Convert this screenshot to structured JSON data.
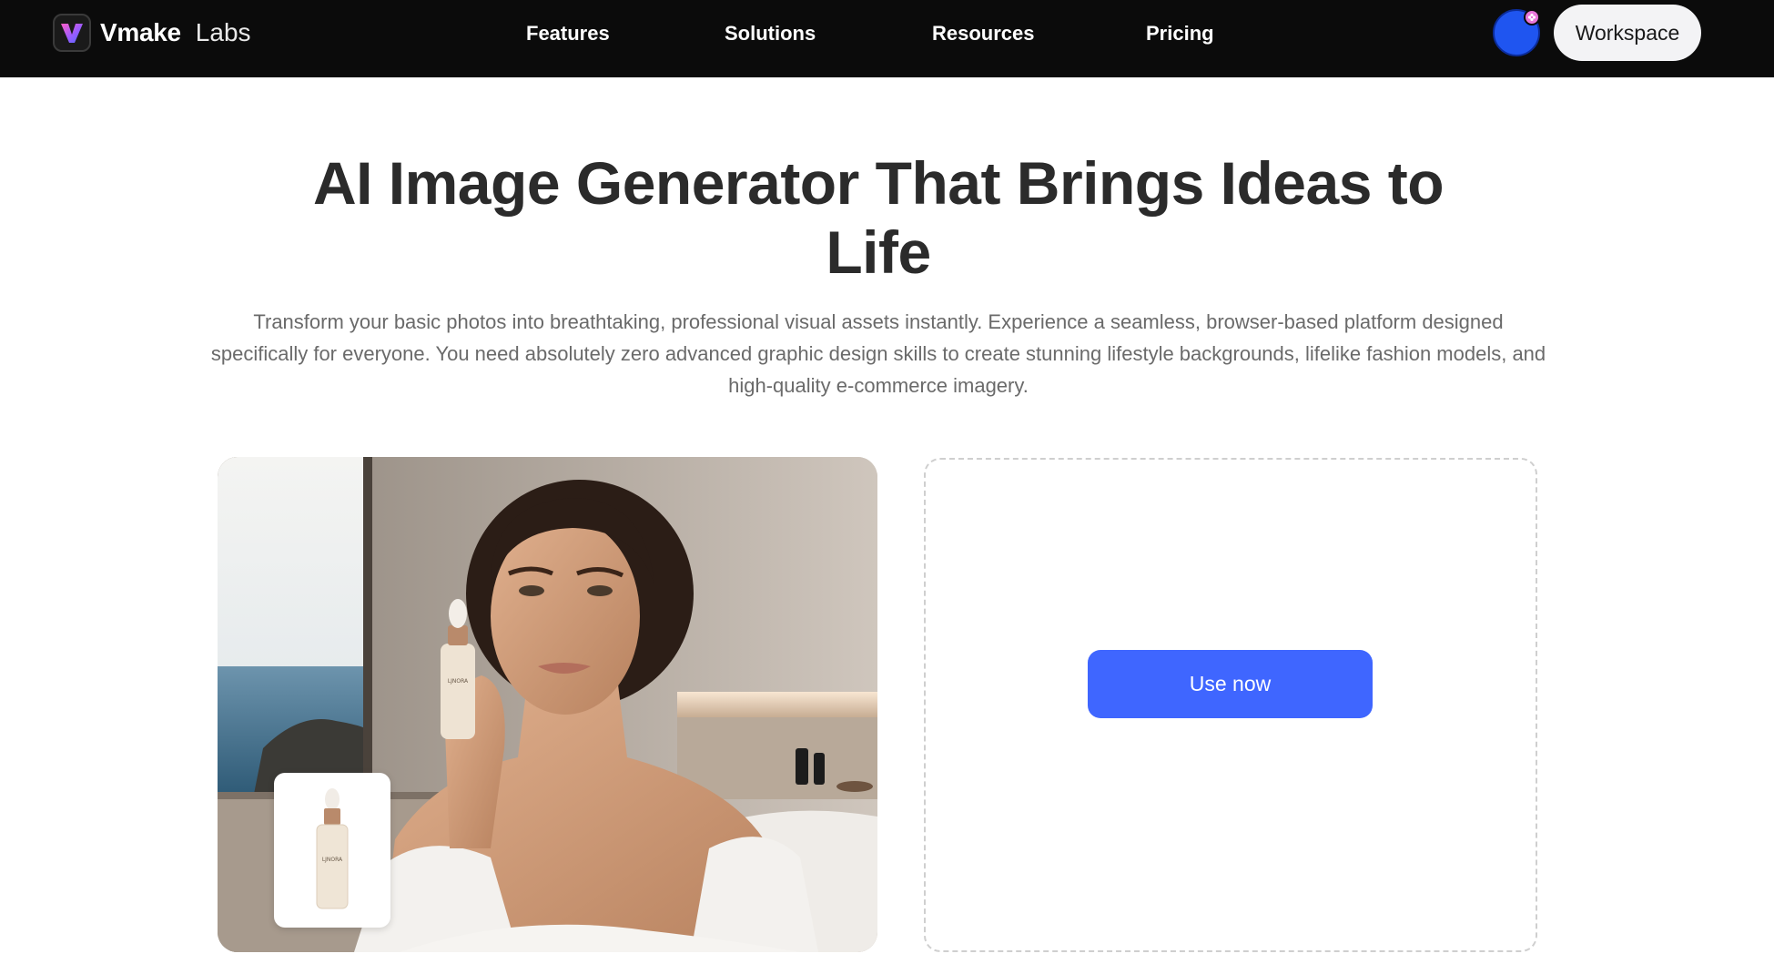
{
  "nav": {
    "brand_name": "Vmake",
    "brand_suffix": "Labs",
    "links": [
      "Features",
      "Solutions",
      "Resources",
      "Pricing"
    ],
    "workspace_label": "Workspace",
    "avatar_color": "#1f55f0",
    "badge_color": "#e877d9",
    "badge_icon": "flower-icon"
  },
  "hero": {
    "title": "AI Image Generator That Brings Ideas to Life",
    "description": "Transform your basic photos into breathtaking, professional visual assets instantly. Experience a seamless, browser-based platform designed specifically for everyone. You need absolutely zero advanced graphic design skills to create stunning lifestyle backgrounds, lifelike fashion models, and high-quality e-commerce imagery."
  },
  "demo": {
    "product_brand": "LJNORA"
  },
  "upload": {
    "cta_label": "Use now"
  },
  "colors": {
    "nav_bg": "#0b0b0b",
    "accent": "#3f66ff",
    "title_text": "#2b2b2b",
    "body_text": "#6a6a6a"
  }
}
